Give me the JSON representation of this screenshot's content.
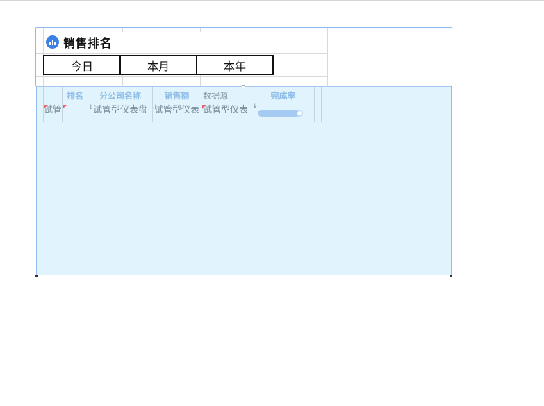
{
  "header": {
    "title": "销售排名",
    "icon": "bar-chart-icon"
  },
  "tabs": [
    {
      "label": "今日"
    },
    {
      "label": "本月"
    },
    {
      "label": "本年"
    }
  ],
  "table": {
    "columns": [
      "排名",
      "分公司名称",
      "销售额",
      "数据源",
      "完成率"
    ],
    "row": {
      "cell_1": "试管",
      "cell_3": "试管型仪表盘",
      "cell_4": "试管型仪表",
      "cell_5": "试管型仪表"
    },
    "progress_fraction": 0.9
  },
  "colors": {
    "accent": "#3b7fe8",
    "panel_bg": "#e1f3fd",
    "selection": "#93bdf0",
    "flag": "#e8636b"
  }
}
